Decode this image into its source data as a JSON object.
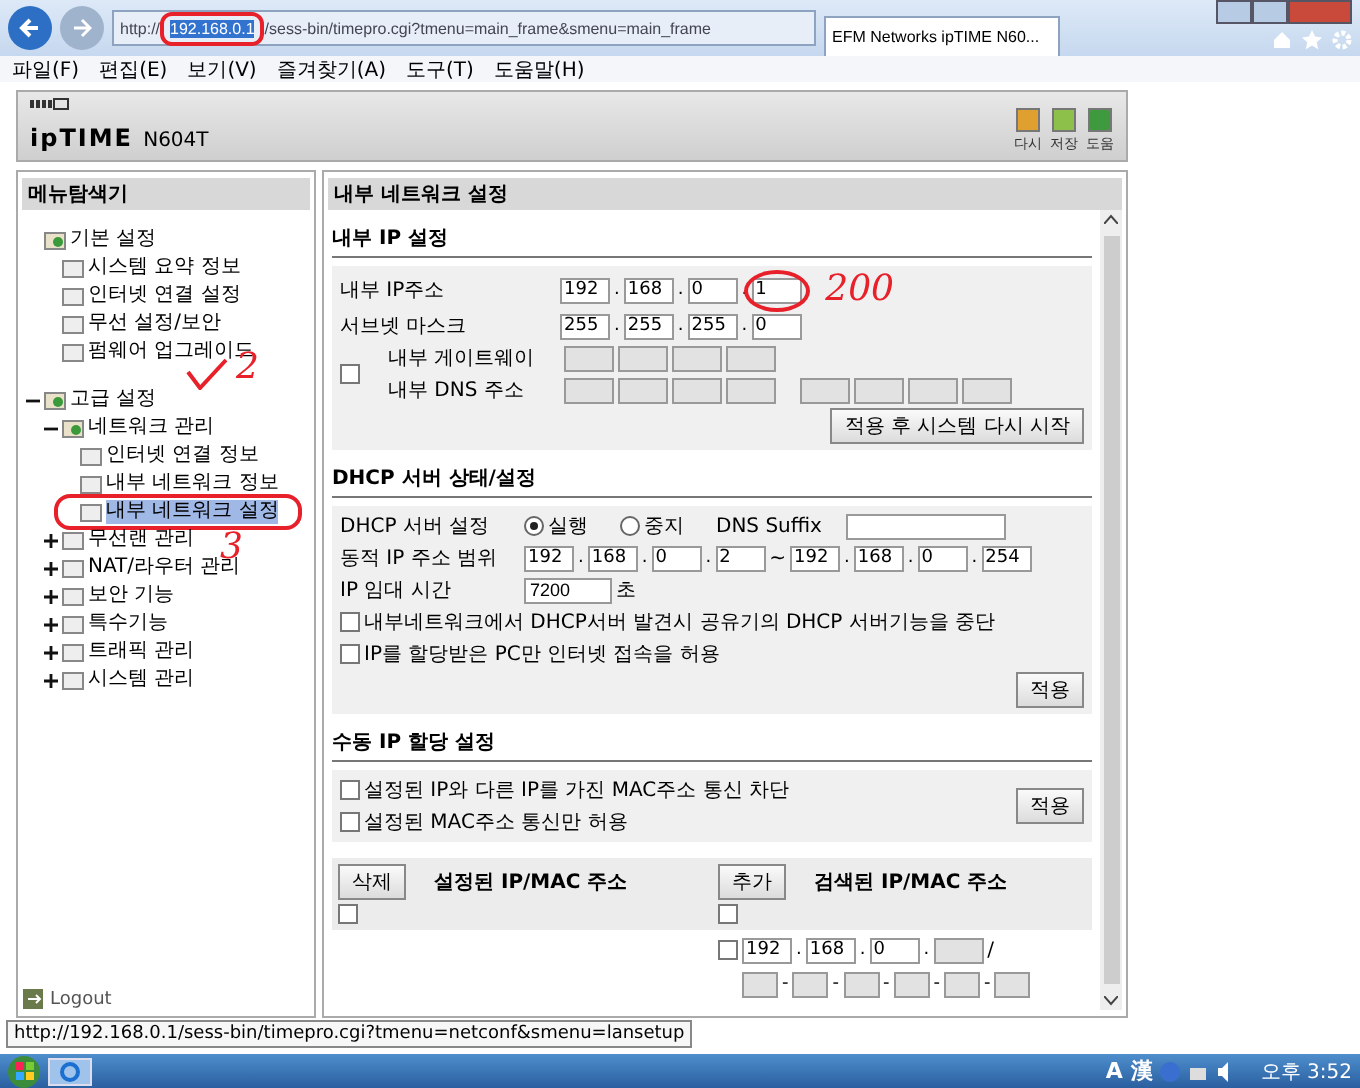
{
  "browser": {
    "address": {
      "scheme": "http://",
      "host": "192.168.0.1",
      "path": "/sess-bin/timepro.cgi?tmenu=main_frame&smenu=main_frame"
    },
    "tab_title": "EFM Networks ipTIME N60...",
    "menu": [
      "파일(F)",
      "편집(E)",
      "보기(V)",
      "즐겨찾기(A)",
      "도구(T)",
      "도움말(H)"
    ]
  },
  "header": {
    "brand": "ipTIME",
    "model": "N604T",
    "buttons": [
      {
        "label": "다시",
        "color": "#e0a030"
      },
      {
        "label": "저장",
        "color": "#8cc04a"
      },
      {
        "label": "도움",
        "color": "#3f9a3f"
      }
    ]
  },
  "sidebar": {
    "title": "메뉴탐색기",
    "tree": [
      {
        "label": "기본 설정",
        "selected": false,
        "children": [
          {
            "label": "시스템 요약 정보",
            "selected": false
          },
          {
            "label": "인터넷 연결 설정",
            "selected": false
          },
          {
            "label": "무선 설정/보안",
            "selected": false
          },
          {
            "label": "펌웨어 업그레이드",
            "selected": false
          }
        ]
      },
      {
        "label": "고급 설정",
        "selected": false,
        "expanded": true,
        "children": [
          {
            "label": "네트워크 관리",
            "selected": false,
            "expanded": true,
            "children": [
              {
                "label": "인터넷 연결 정보",
                "selected": false
              },
              {
                "label": "내부 네트워크 정보",
                "selected": false
              },
              {
                "label": "내부 네트워크 설정",
                "selected": true
              }
            ]
          },
          {
            "label": "무선랜 관리",
            "selected": false,
            "expanded": false
          },
          {
            "label": "NAT/라우터 관리",
            "selected": false,
            "expanded": false
          },
          {
            "label": "보안 기능",
            "selected": false,
            "expanded": false
          },
          {
            "label": "특수기능",
            "selected": false,
            "expanded": false
          },
          {
            "label": "트래픽 관리",
            "selected": false,
            "expanded": false
          },
          {
            "label": "시스템 관리",
            "selected": false,
            "expanded": false
          }
        ]
      }
    ],
    "logout": "Logout"
  },
  "main": {
    "title": "내부 네트워크 설정",
    "ip_separator": ".",
    "lan": {
      "heading": "내부 IP 설정",
      "ip_label": "내부 IP주소",
      "ip": [
        "192",
        "168",
        "0",
        "1"
      ],
      "mask_label": "서브넷 마스크",
      "mask": [
        "255",
        "255",
        "255",
        "0"
      ],
      "gateway": {
        "checked": false,
        "gateway_label": "내부 게이트웨이",
        "dns_label": "내부 DNS 주소"
      },
      "button": "적용 후 시스템 다시 시작"
    },
    "dhcp": {
      "heading": "DHCP 서버 상태/설정",
      "server_label": "DHCP 서버 설정",
      "options": [
        {
          "label": "실행",
          "selected": true
        },
        {
          "label": "중지",
          "selected": false
        }
      ],
      "suffix_label": "DNS Suffix",
      "range_label": "동적 IP 주소 범위",
      "range_start": [
        "192",
        "168",
        "0",
        "2"
      ],
      "range_sep": "~",
      "range_end": [
        "192",
        "168",
        "0",
        "254"
      ],
      "lease_label": "IP 임대 시간",
      "lease": "7200",
      "lease_unit": "초",
      "checks": [
        {
          "label": "내부네트워크에서 DHCP서버 발견시 공유기의 DHCP 서버기능을 중단",
          "checked": false
        },
        {
          "label": "IP를 할당받은 PC만 인터넷 접속을 허용",
          "checked": false
        }
      ],
      "button": "적용"
    },
    "manual": {
      "heading": "수동 IP 할당 설정",
      "checks": [
        {
          "label": "설정된 IP와 다른 IP를 가진 MAC주소 통신 차단",
          "checked": false
        },
        {
          "label": "설정된 MAC주소 통신만 허용",
          "checked": false
        }
      ],
      "button": "적용",
      "left": {
        "button": "삭제",
        "heading": "설정된 IP/MAC 주소",
        "checked": false
      },
      "right": {
        "button": "추가",
        "heading": "검색된 IP/MAC 주소",
        "checked": false
      },
      "entry": {
        "checked": false,
        "ip": [
          "192",
          "168",
          "0"
        ],
        "slash": "/",
        "mac_separator": "-"
      }
    }
  },
  "annotations": [
    "2",
    "3",
    "200"
  ],
  "status_tip": "http://192.168.0.1/sess-bin/timepro.cgi?tmenu=netconf&smenu=lansetup",
  "taskbar": {
    "ime": [
      "A",
      "漢"
    ],
    "clock": "오후 3:52"
  }
}
